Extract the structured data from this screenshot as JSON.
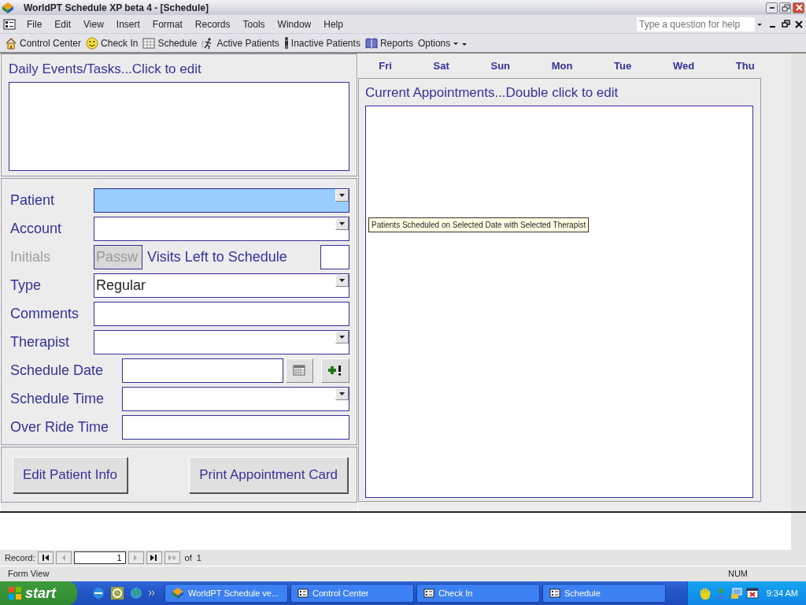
{
  "window": {
    "title": "WorldPT Schedule XP beta 4 - [Schedule]"
  },
  "menu": [
    "File",
    "Edit",
    "View",
    "Insert",
    "Format",
    "Records",
    "Tools",
    "Window",
    "Help"
  ],
  "help_box": {
    "placeholder": "Type a question for help"
  },
  "toolbar": [
    {
      "kind": "button",
      "label": "Control Center"
    },
    {
      "kind": "button",
      "label": "Check In"
    },
    {
      "kind": "button",
      "label": "Schedule"
    },
    {
      "kind": "button",
      "label": "Active Patients"
    },
    {
      "kind": "button",
      "label": "Inactive Patients"
    },
    {
      "kind": "button",
      "label": "Reports"
    },
    {
      "kind": "dropdown",
      "label": "Options"
    }
  ],
  "daily_events": {
    "title": "Daily Events/Tasks...Click to edit"
  },
  "patient_fields": [
    {
      "kind": "combo",
      "label": "Patient",
      "focused": true,
      "disabled": false
    },
    {
      "kind": "combo",
      "label": "Account",
      "focused": false,
      "disabled": false
    },
    {
      "kind": "initials",
      "label": "Initials",
      "value": "Passw",
      "extra_label": "Visits Left to Schedule",
      "focused": false,
      "disabled": true
    },
    {
      "kind": "combo",
      "label": "Type",
      "value": "Regular",
      "focused": false,
      "disabled": false
    },
    {
      "kind": "text",
      "label": "Comments",
      "focused": false,
      "disabled": false
    },
    {
      "kind": "combo",
      "label": "Therapist",
      "focused": false,
      "disabled": false
    }
  ],
  "schedule_fields": [
    {
      "kind": "date",
      "label": "Schedule Date",
      "focused": false,
      "disabled": false
    },
    {
      "kind": "combo",
      "label": "Schedule Time",
      "focused": false,
      "disabled": false
    },
    {
      "kind": "text",
      "label": "Over Ride Time",
      "focused": false,
      "disabled": false
    }
  ],
  "buttons": [
    "Edit Patient Info",
    "Print Appointment Card"
  ],
  "calendar": {
    "days": [
      "Fri",
      "Sat",
      "Sun",
      "Mon",
      "Tue",
      "Wed",
      "Thu"
    ]
  },
  "appointments": {
    "title": "Current Appointments...Double click to edit",
    "tooltip": "Patients Scheduled on Selected Date with Selected Therapist"
  },
  "record_nav": {
    "label": "Record:",
    "current": "1",
    "of": "of",
    "total": "1"
  },
  "status_bar": {
    "mode": "Form View",
    "num": "NUM"
  },
  "taskbar": {
    "start": "start",
    "tasks": [
      "WorldPT Schedule ve...",
      "Control Center",
      "Check In",
      "Schedule"
    ],
    "clock": "9:34 AM"
  }
}
